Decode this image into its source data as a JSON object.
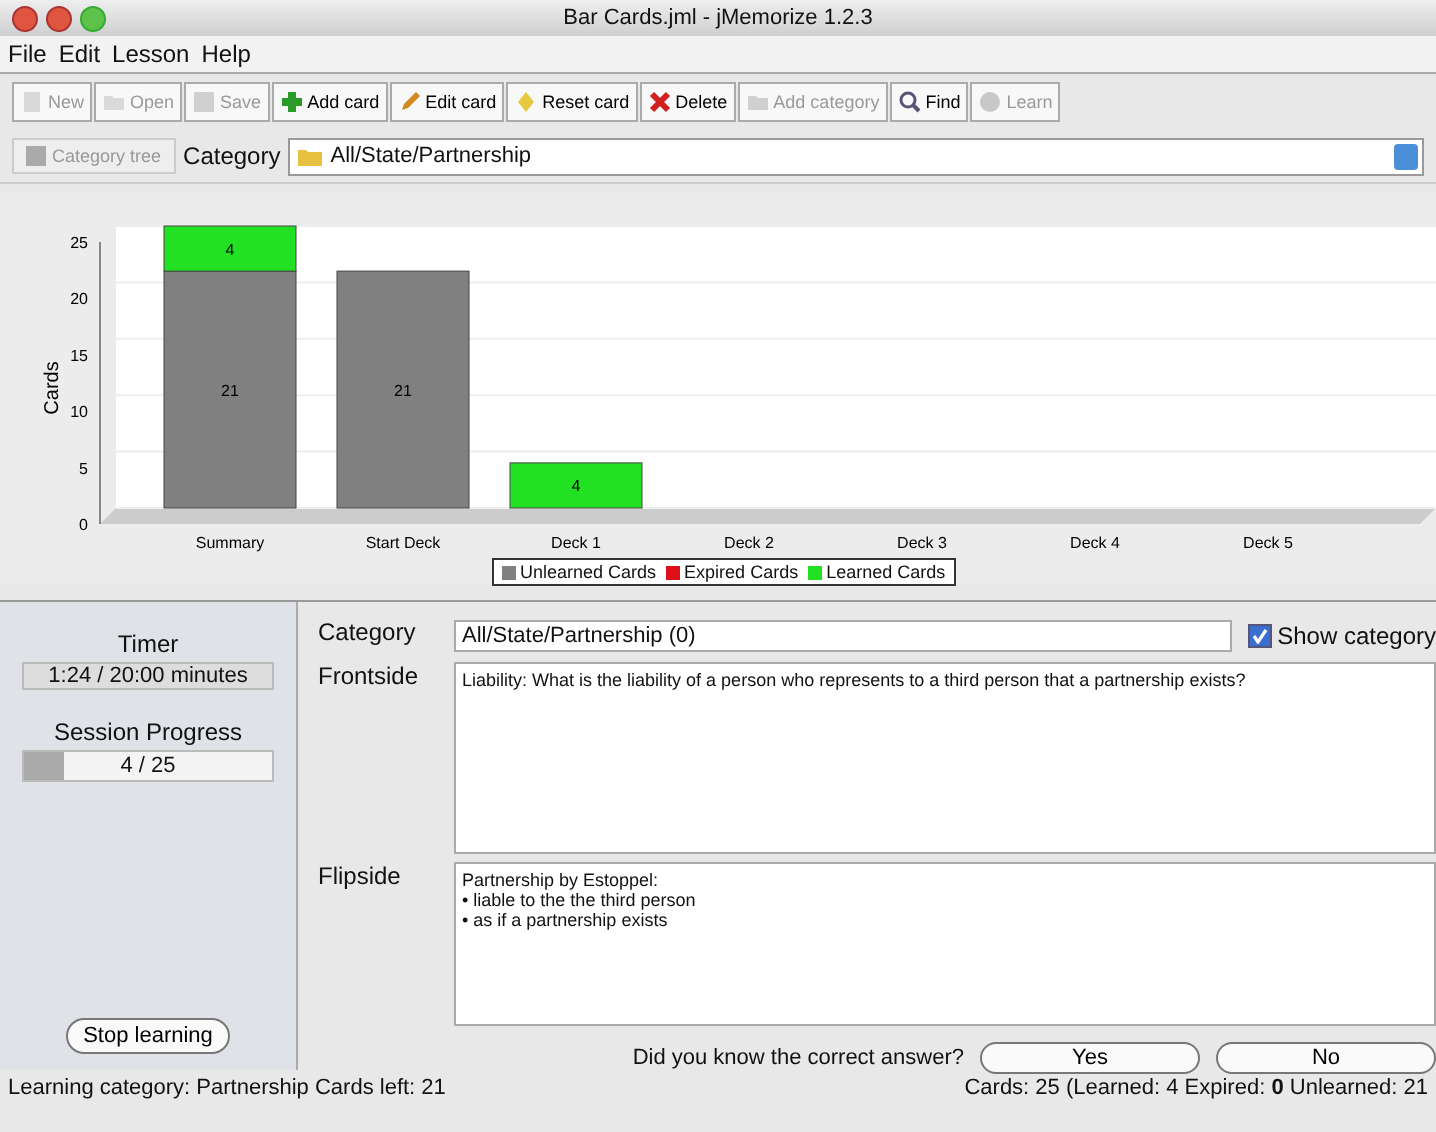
{
  "window": {
    "title": "Bar Cards.jml - jMemorize 1.2.3"
  },
  "menu": [
    "File",
    "Edit",
    "Lesson",
    "Help"
  ],
  "toolbar": [
    {
      "label": "New",
      "disabled": true
    },
    {
      "label": "Open",
      "disabled": true
    },
    {
      "label": "Save",
      "disabled": true
    },
    {
      "label": "Add card",
      "disabled": false
    },
    {
      "label": "Edit card",
      "disabled": false
    },
    {
      "label": "Reset card",
      "disabled": false
    },
    {
      "label": "Delete",
      "disabled": false
    },
    {
      "label": "Add category",
      "disabled": true
    },
    {
      "label": "Find",
      "disabled": false
    },
    {
      "label": "Learn",
      "disabled": true
    }
  ],
  "category_bar": {
    "tree_button": "Category tree",
    "label": "Category",
    "value": "All/State/Partnership"
  },
  "chart": {
    "chart_data": {
      "type": "bar",
      "stacked": true,
      "ylabel": "Cards",
      "categories": [
        "Summary",
        "Start Deck",
        "Deck 1",
        "Deck 2",
        "Deck 3",
        "Deck 4",
        "Deck 5"
      ],
      "series": [
        {
          "name": "Unlearned Cards",
          "color": "#808080",
          "values": [
            21,
            21,
            0,
            0,
            0,
            0,
            0
          ],
          "value_labels": [
            "21",
            "21",
            null,
            null,
            null,
            null,
            null
          ]
        },
        {
          "name": "Expired Cards",
          "color": "#e0101a",
          "values": [
            0,
            0,
            0,
            0,
            0,
            0,
            0
          ],
          "value_labels": [
            null,
            null,
            null,
            null,
            null,
            null,
            null
          ]
        },
        {
          "name": "Learned Cards",
          "color": "#22e022",
          "values": [
            4,
            0,
            4,
            0,
            0,
            0,
            0
          ],
          "value_labels": [
            "4",
            null,
            "4",
            null,
            null,
            null,
            null
          ]
        }
      ],
      "ylim": [
        0,
        25
      ],
      "yticks": [
        0,
        5,
        10,
        15,
        20,
        25
      ],
      "grid": true,
      "legend": true
    }
  },
  "session": {
    "timer_label": "Timer",
    "timer": "1:24 / 20:00 minutes",
    "progress_label": "Session Progress",
    "progress_text": "4 / 25",
    "level": 0.16,
    "stop_button": "Stop learning"
  },
  "card": {
    "category_label": "Category",
    "category": "All/State/Partnership (0)",
    "show_category": {
      "label": "Show category",
      "checked": true
    },
    "frontside_label": "Frontside",
    "frontside": "Liability: What is the liability of a person who represents to a third person that a partnership exists?",
    "flipside_label": "Flipside",
    "flipside": [
      "Partnership by Estoppel:",
      "• liable to the the third person",
      "• as if a partnership exists"
    ],
    "question": "Did you know the correct answer?",
    "buttons": [
      "Yes",
      "No"
    ]
  },
  "status_bar": {
    "left": "Learning category: Partnership  Cards left: 21",
    "right": "Cards: 25 (Learned: 4  Expired: **0**  Unlearned: 21"
  }
}
